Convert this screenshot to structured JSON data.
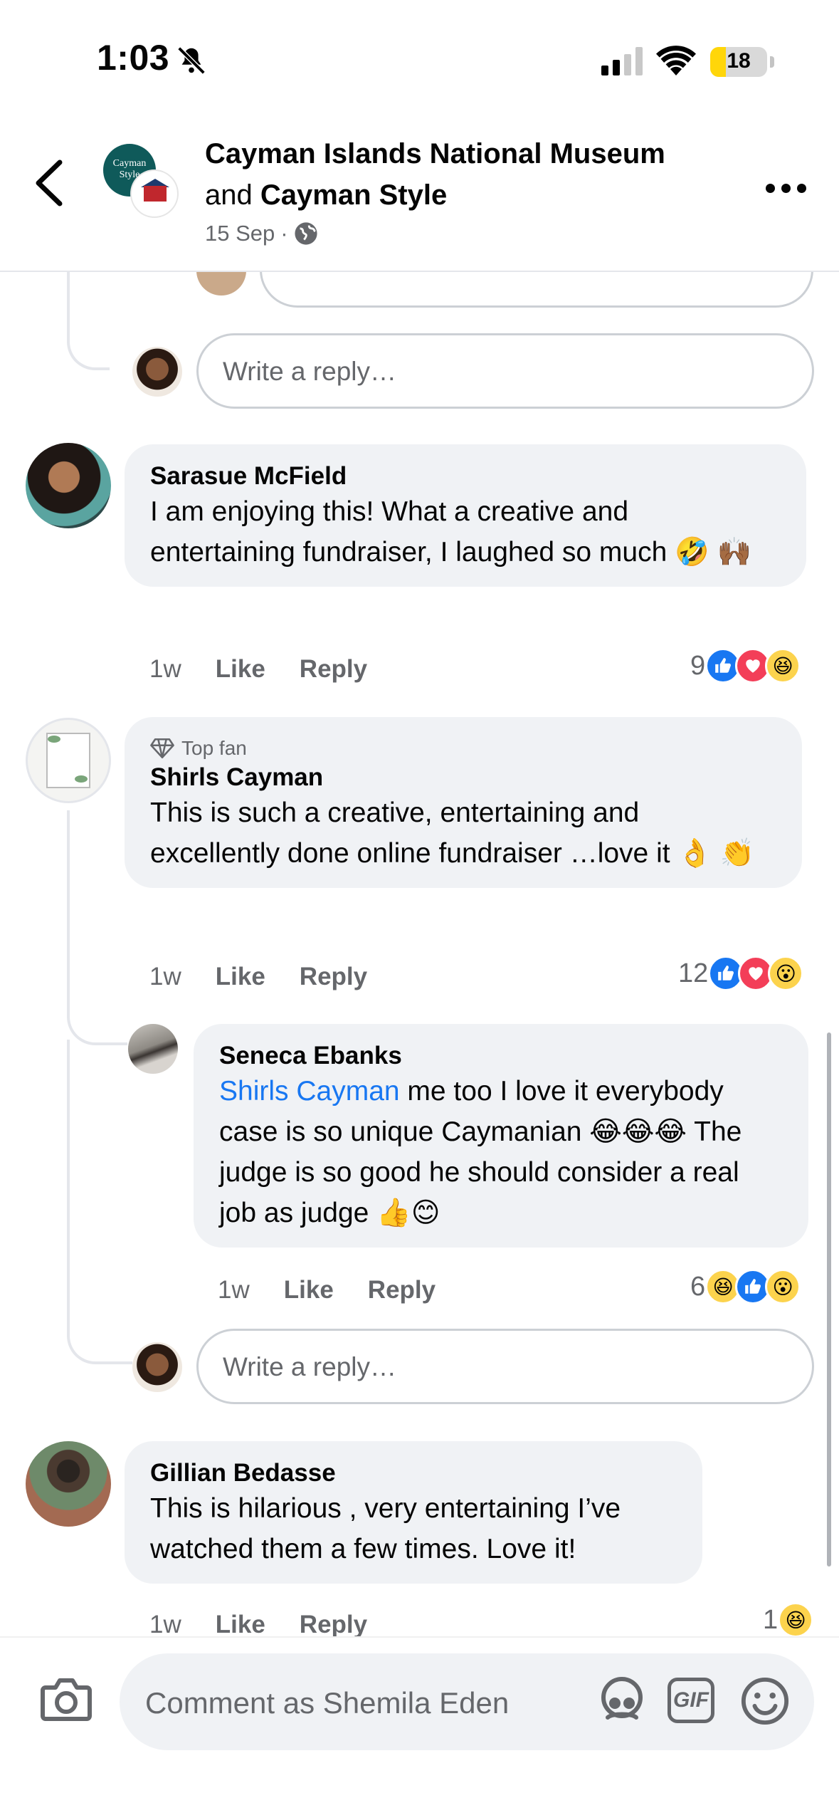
{
  "status_bar": {
    "time": "1:03",
    "battery": "18"
  },
  "header": {
    "title_line1": "Cayman Islands National Museum",
    "title_and": "and",
    "title_page2": "Cayman Style",
    "date": "15 Sep",
    "separator": "·",
    "avatar1_text": "Cayman Style"
  },
  "comments": [
    {
      "author": "Sarasue McField",
      "text": "I am enjoying this! What a creative and entertaining fundraiser, I laughed so much 🤣 🙌🏾",
      "time": "1w",
      "like": "Like",
      "reply": "Reply",
      "reaction_count": "9"
    },
    {
      "badge": "Top fan",
      "author": "Shirls Cayman",
      "text": "This is such a creative, entertaining and excellently done online fundraiser …love it 👌 👏",
      "time": "1w",
      "like": "Like",
      "reply": "Reply",
      "reaction_count": "12"
    },
    {
      "author": "Seneca Ebanks",
      "mention": "Shirls Cayman",
      "text": " me too I love it everybody case is so unique Caymanian 😂😂😂 The judge  is so good he should consider a real job as judge 👍😊",
      "time": "1w",
      "like": "Like",
      "reply": "Reply",
      "reaction_count": "6"
    },
    {
      "author": "Gillian Bedasse",
      "text": "This is hilarious , very entertaining I’ve watched them a few times.  Love it!",
      "time": "1w",
      "like": "Like",
      "reply": "Reply",
      "reaction_count": "1"
    }
  ],
  "reply_placeholder": "Write a reply…",
  "composer": {
    "placeholder": "Comment as Shemila Eden",
    "gif": "GIF"
  },
  "colors": {
    "accent": "#1877f2",
    "bubble": "#f0f2f5",
    "muted": "#65676b"
  }
}
